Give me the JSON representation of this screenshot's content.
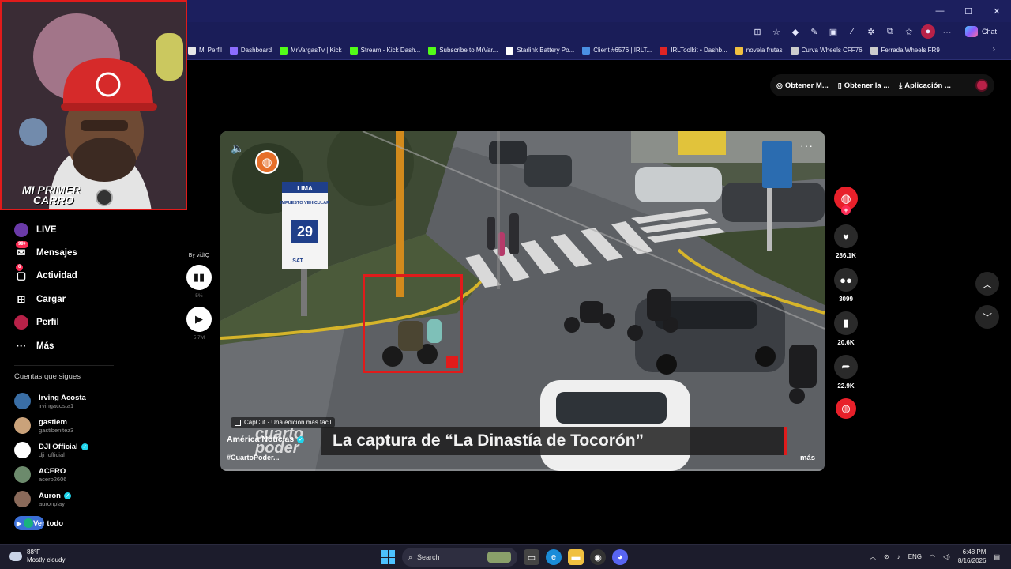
{
  "window": {
    "controls": [
      "—",
      "☐",
      "✕"
    ],
    "chat_label": "Chat"
  },
  "bookmarks": [
    {
      "label": "Mi Perfil",
      "color": "#e6e6e6"
    },
    {
      "label": "Dashboard",
      "color": "#8c6cff"
    },
    {
      "label": "MrVargasTv | Kick",
      "color": "#53fc18"
    },
    {
      "label": "Stream - Kick Dash...",
      "color": "#53fc18"
    },
    {
      "label": "Subscribe to MrVar...",
      "color": "#53fc18"
    },
    {
      "label": "Starlink Battery Po...",
      "color": "#ffffff"
    },
    {
      "label": "Client #6576 | IRLT...",
      "color": "#4a90e2"
    },
    {
      "label": "IRLToolkit • Dashb...",
      "color": "#e02424"
    },
    {
      "label": "novela frutas",
      "color": "#f0c040"
    },
    {
      "label": "Curva Wheels CFF76",
      "color": "#cccccc"
    },
    {
      "label": "Ferrada Wheels FR9",
      "color": "#cccccc"
    }
  ],
  "header": {
    "get_coins": "Obtener M...",
    "get_app": "Obtener la ...",
    "app": "Aplicación ..."
  },
  "nav": [
    {
      "label": "LIVE",
      "icon": "live-avatar-icon"
    },
    {
      "label": "Mensajes",
      "icon": "messages-icon",
      "badge": "99+"
    },
    {
      "label": "Actividad",
      "icon": "activity-icon",
      "badge": "6"
    },
    {
      "label": "Cargar",
      "icon": "upload-icon"
    },
    {
      "label": "Perfil",
      "icon": "profile-avatar-icon"
    },
    {
      "label": "Más",
      "icon": "more-icon"
    }
  ],
  "following": {
    "title": "Cuentas que sigues",
    "accounts": [
      {
        "name": "Irving Acosta",
        "handle": "irvingacosta1",
        "verified": false,
        "color": "#3a6ea5"
      },
      {
        "name": "gastiem",
        "handle": "gastibenitez3",
        "verified": false,
        "color": "#caa27a"
      },
      {
        "name": "DJI Official",
        "handle": "dji_official",
        "verified": true,
        "color": "#ffffff"
      },
      {
        "name": "ACERO",
        "handle": "acero2606",
        "verified": false,
        "color": "#6c8a6c"
      },
      {
        "name": "Auron",
        "handle": "auronplay",
        "verified": true,
        "color": "#8a6a5a"
      }
    ],
    "see_all": "Ver todo"
  },
  "vidiq": {
    "by": "By vidIQ",
    "score": "5%",
    "views": "5.7M"
  },
  "video": {
    "capcut": "CapCut · Una edición más fácil",
    "author": "América Noticias",
    "hashtag": "#CuartoPoder...",
    "more": "más",
    "watermark": "cuarto poder",
    "caption": "La captura de “La Dinastía de Tocorón”",
    "sign_lima": "LIMA",
    "sign_impuesto": "IMPUESTO VEHICULAR",
    "sign_num": "29",
    "sign_sat": "SAT"
  },
  "rail": {
    "likes": "286.1K",
    "comments": "3099",
    "saves": "20.6K",
    "shares": "22.9K"
  },
  "webcam": {
    "overlay_line1": "MI PRIMER",
    "overlay_line2": "CARRO"
  },
  "taskbar": {
    "temp": "88°F",
    "weather": "Mostly cloudy",
    "search": "Search",
    "lang": "ENG",
    "time": "6:48 PM",
    "date": "8/16/2026"
  },
  "colors": {
    "accent_red": "#fe2c55",
    "browser_chrome": "#1a1d58",
    "highlight_box": "#e01b1b"
  }
}
